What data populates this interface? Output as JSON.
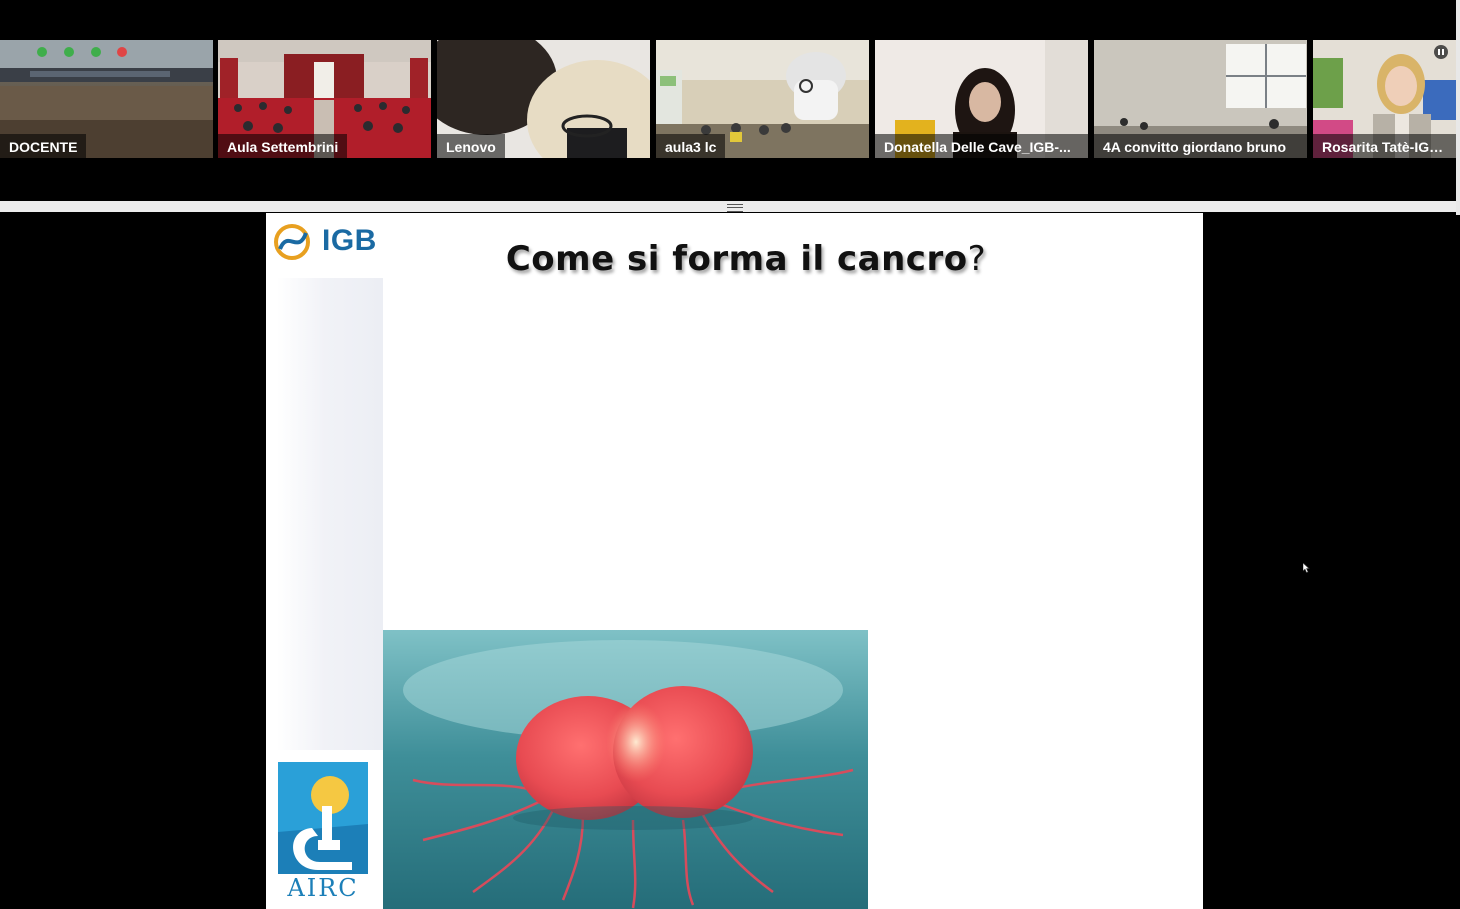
{
  "participants": [
    {
      "name": "DOCENTE"
    },
    {
      "name": "Aula Settembrini"
    },
    {
      "name": "Lenovo"
    },
    {
      "name": "aula3 lc"
    },
    {
      "name": "Donatella Delle Cave_IGB-..."
    },
    {
      "name": "4A convitto giordano bruno"
    },
    {
      "name": "Rosarita Tatè-IGB-..."
    }
  ],
  "slide": {
    "title": "Come si forma il cancro",
    "title_mark": "?",
    "logo_top": "IGB",
    "logo_bottom": "AIRC"
  },
  "icons": {
    "pause": "pause-icon",
    "resize_grip": "drag-handle-icon",
    "cursor": "mouse-pointer-icon"
  },
  "colors": {
    "igb_blue": "#1a6aa3",
    "igb_orange": "#e8a020",
    "airc_blue": "#2aa0d8",
    "airc_yellow": "#f5c842",
    "background": "#000000"
  }
}
